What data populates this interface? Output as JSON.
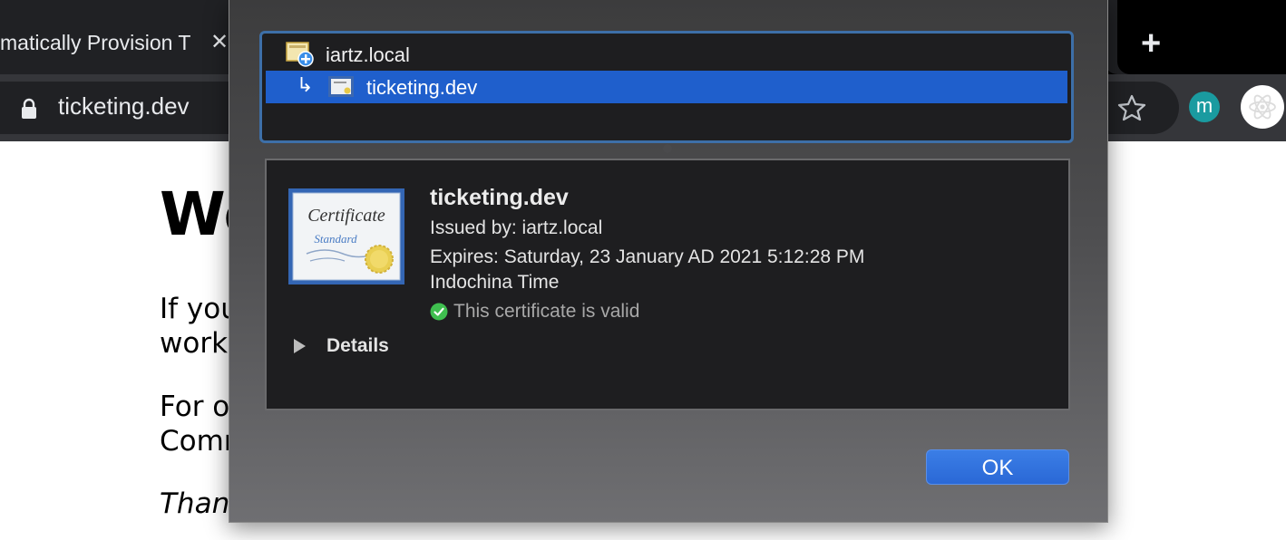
{
  "browser": {
    "tab_title": "matically Provision T",
    "close_glyph": "✕",
    "new_tab_glyph": "+",
    "url": "ticketing.dev",
    "avatar_letter": "m",
    "icons": [
      "lock-icon",
      "star-icon",
      "react-extension-icon"
    ]
  },
  "page": {
    "heading": "We",
    "paragraphs": [
      {
        "line1": "If you",
        "line2": "worki"
      },
      {
        "line1": "For o",
        "line2": "Comm"
      }
    ],
    "closing": "Thank"
  },
  "dialog": {
    "cert_list": [
      {
        "label": "iartz.local",
        "icon": "root-certificate-icon",
        "selected": false
      },
      {
        "label": "ticketing.dev",
        "icon": "certificate-icon",
        "selected": true,
        "arrow": "↳"
      }
    ],
    "detail": {
      "name": "ticketing.dev",
      "issued_by": "Issued by: iartz.local",
      "expires_line1": "Expires: Saturday, 23 January AD 2021 5:12:28 PM",
      "expires_line2": "Indochina Time",
      "status": "This certificate is valid",
      "details_label": "Details",
      "image_text_top": "Certificate",
      "image_text_bottom": "Standard"
    },
    "ok_label": "OK",
    "colors": {
      "selection": "#1f5fcc",
      "ok_button": "#2a68d6",
      "valid_green": "#3fbf4f"
    }
  }
}
